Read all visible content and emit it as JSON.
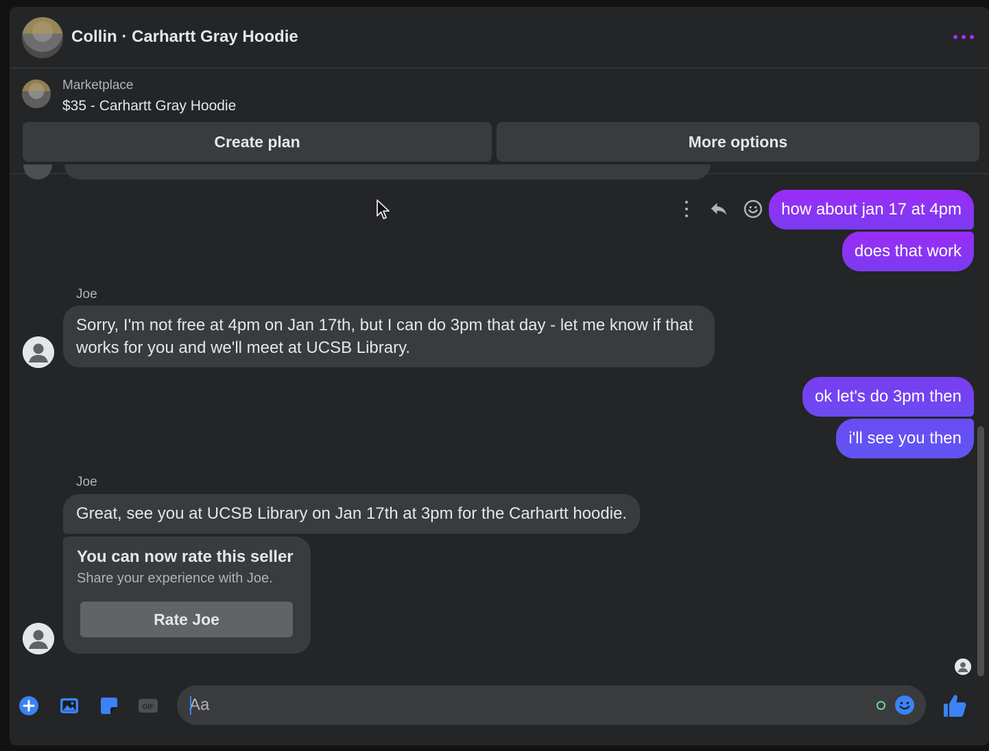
{
  "header": {
    "title": "Collin · Carhartt Gray Hoodie",
    "accent_color": "#a035ff"
  },
  "marketplace": {
    "label": "Marketplace",
    "listing": "$35 - Carhartt Gray Hoodie"
  },
  "actions": {
    "create_plan": "Create plan",
    "more_options": "More options"
  },
  "messages": {
    "outgoing_1": "how about jan 17 at 4pm",
    "outgoing_2": "does that work",
    "sender_1": "Joe",
    "incoming_1": "Sorry, I'm not free at 4pm on Jan 17th, but I can do 3pm that day - let me know if that works for you and we'll meet at UCSB Library.",
    "outgoing_3": "ok let's do 3pm then",
    "outgoing_4": "i'll see you then",
    "sender_2": "Joe",
    "incoming_2": "Great, see you at UCSB Library on Jan 17th at 3pm for the Carhartt hoodie."
  },
  "rate_card": {
    "title": "You can now rate this seller",
    "subtitle": "Share your experience with Joe.",
    "button": "Rate Joe"
  },
  "composer": {
    "placeholder": "Aa",
    "value": ""
  },
  "icons": [
    "more-icon",
    "kebab-icon",
    "reply-icon",
    "react-icon",
    "plus-icon",
    "image-icon",
    "sticker-icon",
    "gif-icon",
    "emoji-icon",
    "like-icon"
  ],
  "colors": {
    "outgoing_bubble": "#9b2cf7",
    "incoming_bubble": "#3a3b3c",
    "composer_icon": "#3b82f6"
  }
}
